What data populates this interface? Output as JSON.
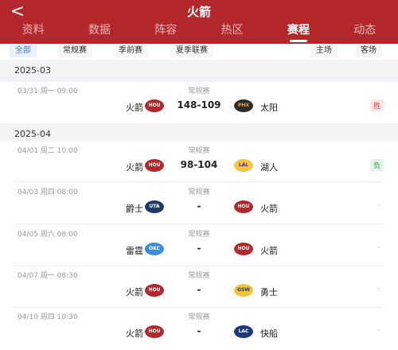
{
  "header": {
    "back_icon": "chevron-left-icon",
    "back_glyph": "<",
    "title": "火箭",
    "tabs": [
      {
        "label": "资料",
        "active": false
      },
      {
        "label": "数据",
        "active": false
      },
      {
        "label": "阵容",
        "active": false
      },
      {
        "label": "热区",
        "active": false
      },
      {
        "label": "赛程",
        "active": true
      },
      {
        "label": "动态",
        "active": false
      }
    ],
    "color": "#b4282c"
  },
  "filters": {
    "types": [
      "全部",
      "常规赛",
      "季前赛",
      "夏季联赛"
    ],
    "venue": [
      "主场",
      "客场"
    ],
    "active_color": "#3b7be0"
  },
  "months": [
    {
      "label": "2025-03"
    },
    {
      "label": "2025-04"
    }
  ],
  "games": [
    {
      "date": "03/31  周一 09:00",
      "type": "常规赛",
      "team_left": "火箭",
      "logo_left": "HOU",
      "score": "148-109",
      "logo_right": "PHX",
      "team_right": "太阳",
      "result": "胜"
    },
    {
      "date": "04/01  周二 10:00",
      "type": "常规赛",
      "team_left": "火箭",
      "logo_left": "HOU",
      "score": "98-104",
      "logo_right": "LAL",
      "team_right": "湖人",
      "result": "负"
    },
    {
      "date": "04/03  周四 08:00",
      "type": "常规赛",
      "team_left": "爵士",
      "logo_left": "UTA",
      "score": "-",
      "logo_right": "HOU",
      "team_right": "火箭",
      "result": "-"
    },
    {
      "date": "04/05  周六 08:00",
      "type": "常规赛",
      "team_left": "雷霆",
      "logo_left": "OKC",
      "score": "-",
      "logo_right": "HOU",
      "team_right": "火箭",
      "result": "-"
    },
    {
      "date": "04/07  周一 08:30",
      "type": "常规赛",
      "team_left": "火箭",
      "logo_left": "HOU",
      "score": "-",
      "logo_right": "GSW",
      "team_right": "勇士",
      "result": "-"
    },
    {
      "date": "04/10  周四 10:30",
      "type": "常规赛",
      "team_left": "火箭",
      "logo_left": "HOU",
      "score": "-",
      "logo_right": "LAC",
      "team_right": "快船",
      "result": "-"
    }
  ]
}
